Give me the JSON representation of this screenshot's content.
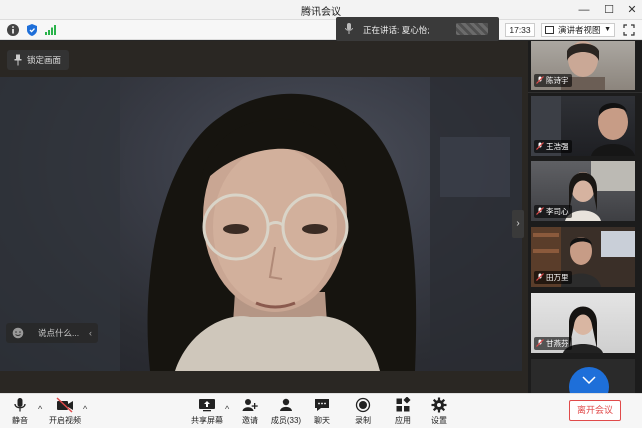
{
  "window": {
    "title": "腾讯会议"
  },
  "topbar": {
    "speaking_label": "正在讲话: 夏心怡;",
    "time": "17:33",
    "view_mode": "演讲者视图"
  },
  "main": {
    "lock_label": "锁定画面",
    "chat_placeholder": "说点什么..."
  },
  "participants": [
    {
      "name": "陈诗宇"
    },
    {
      "name": "王浩强"
    },
    {
      "name": "李司心"
    },
    {
      "name": "田万里"
    },
    {
      "name": "甘燕芬"
    }
  ],
  "toolbar": {
    "mute": "静音",
    "video": "开启视频",
    "share": "共享屏幕",
    "invite": "邀请",
    "members": "成员(33)",
    "chat": "聊天",
    "record": "录制",
    "apps": "应用",
    "settings": "设置",
    "leave": "离开会议"
  },
  "colors": {
    "leave_red": "#e04a4a",
    "accent_blue": "#1e6fd9",
    "signal_green": "#29b34a"
  }
}
